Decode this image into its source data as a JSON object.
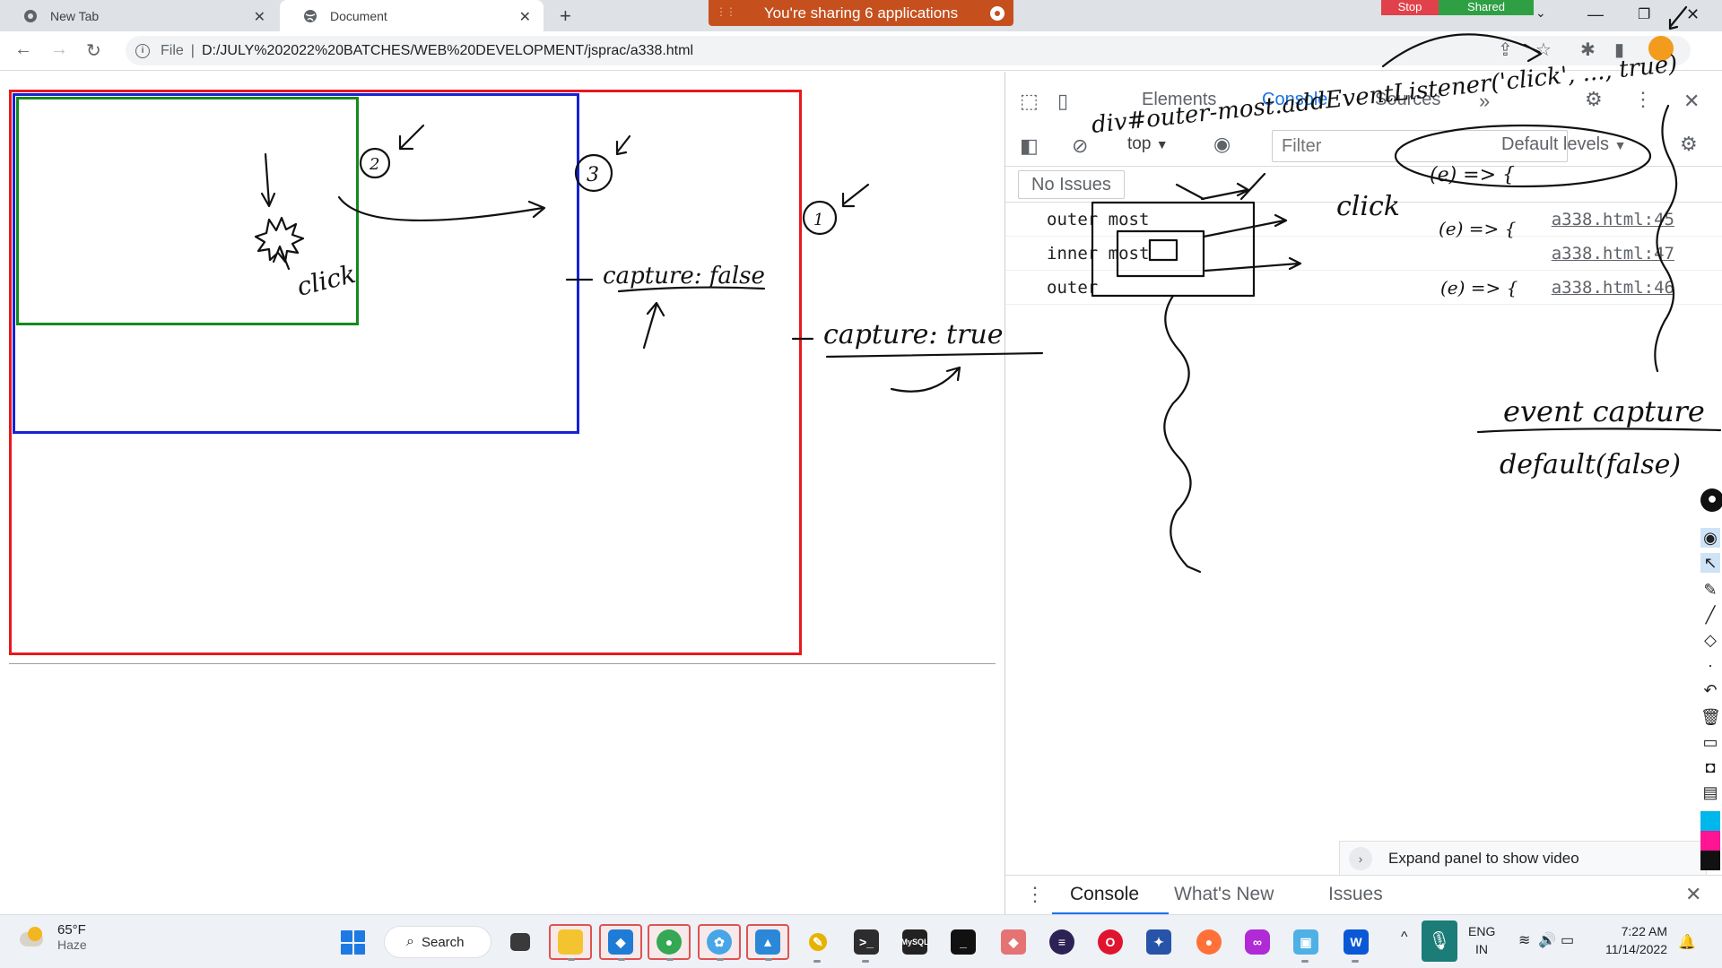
{
  "browser": {
    "tabs": [
      {
        "title": "New Tab",
        "active": false
      },
      {
        "title": "Document",
        "active": true
      }
    ],
    "share_banner": "You're sharing 6 applications",
    "stop_label": "Stop",
    "shared_label": "Shared",
    "address": {
      "scheme": "File",
      "url": "D:/JULY%202022%20BATCHES/WEB%20DEVELOPMENT/jsprac/a338.html"
    }
  },
  "devtools": {
    "tabs": [
      "Elements",
      "Console",
      "Sources"
    ],
    "context": "top",
    "filter_placeholder": "Filter",
    "levels": "Default levels",
    "issues": "No Issues",
    "logs": [
      {
        "message": "outer most",
        "source": "a338.html:45"
      },
      {
        "message": "inner most",
        "source": "a338.html:47"
      },
      {
        "message": "outer",
        "source": "a338.html:46"
      }
    ],
    "expand_panel": "Expand panel to show video",
    "drawer_tabs": [
      "Console",
      "What's New",
      "Issues"
    ]
  },
  "annotations": {
    "circle_1": "1",
    "circle_2": "2",
    "circle_3": "3",
    "click_label": "click",
    "capture_false": "capture: false",
    "capture_true": "capture: true",
    "listener_code": "div#outer-most.addEventListener('click', ..., true)",
    "handler_arrow": "(e) => {",
    "handler_2": "(e) => {",
    "handler_3": "(e) => {",
    "click_right": "click",
    "event_capture": "event capture",
    "default_false": "default(false)"
  },
  "taskbar": {
    "weather_temp": "65°F",
    "weather_cond": "Haze",
    "search_label": "Search",
    "lang_top": "ENG",
    "lang_bottom": "IN",
    "time": "7:22 AM",
    "date": "11/14/2022"
  },
  "colors": {
    "outer_border": "#e8181e",
    "middle_border": "#1722d8",
    "inner_border": "#138a1b",
    "share_banner": "#c5501e"
  }
}
